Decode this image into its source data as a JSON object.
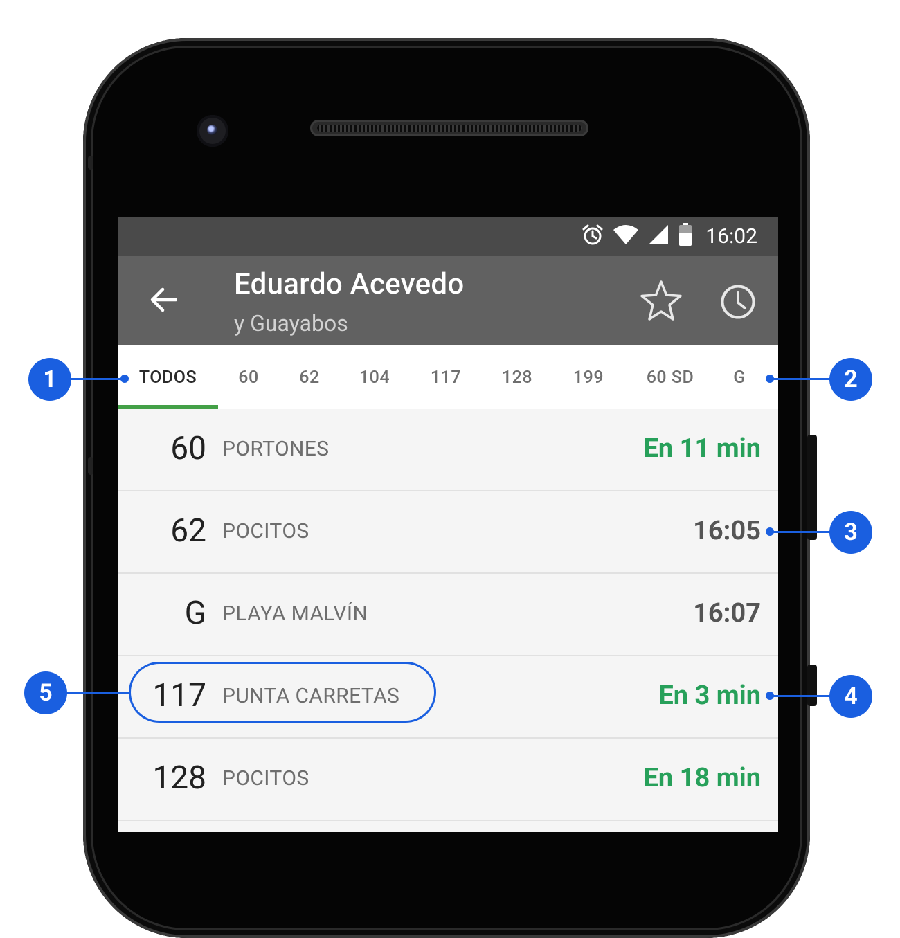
{
  "status_bar": {
    "time": "16:02",
    "icons": [
      "alarm-icon",
      "wifi-icon",
      "signal-icon",
      "battery-icon"
    ]
  },
  "toolbar": {
    "back_icon": "arrow-left-icon",
    "title": "Eduardo Acevedo",
    "subtitle": "y Guayabos",
    "favorite_icon": "star-outline-icon",
    "schedule_icon": "clock-icon"
  },
  "tabs": [
    {
      "label": "TODOS",
      "active": true
    },
    {
      "label": "60"
    },
    {
      "label": "62"
    },
    {
      "label": "104"
    },
    {
      "label": "117"
    },
    {
      "label": "128"
    },
    {
      "label": "199"
    },
    {
      "label": "60 SD"
    },
    {
      "label": "G"
    }
  ],
  "arrivals": [
    {
      "route": "60",
      "destination": "PORTONES",
      "eta": "En 11 min",
      "eta_type": "realtime"
    },
    {
      "route": "62",
      "destination": "POCITOS",
      "eta": "16:05",
      "eta_type": "scheduled"
    },
    {
      "route": "G",
      "destination": "PLAYA MALVÍN",
      "eta": "16:07",
      "eta_type": "scheduled"
    },
    {
      "route": "117",
      "destination": "PUNTA CARRETAS",
      "eta": "En 3 min",
      "eta_type": "realtime"
    },
    {
      "route": "128",
      "destination": "POCITOS",
      "eta": "En 18 min",
      "eta_type": "realtime"
    }
  ],
  "callouts": {
    "one": "1",
    "two": "2",
    "three": "3",
    "four": "4",
    "five": "5"
  },
  "colors": {
    "realtime": "#27a05a",
    "scheduled": "#555555",
    "tab_indicator": "#43a047",
    "toolbar": "#616161",
    "status_bar": "#4a4a4a",
    "callout": "#1a5fe0"
  }
}
